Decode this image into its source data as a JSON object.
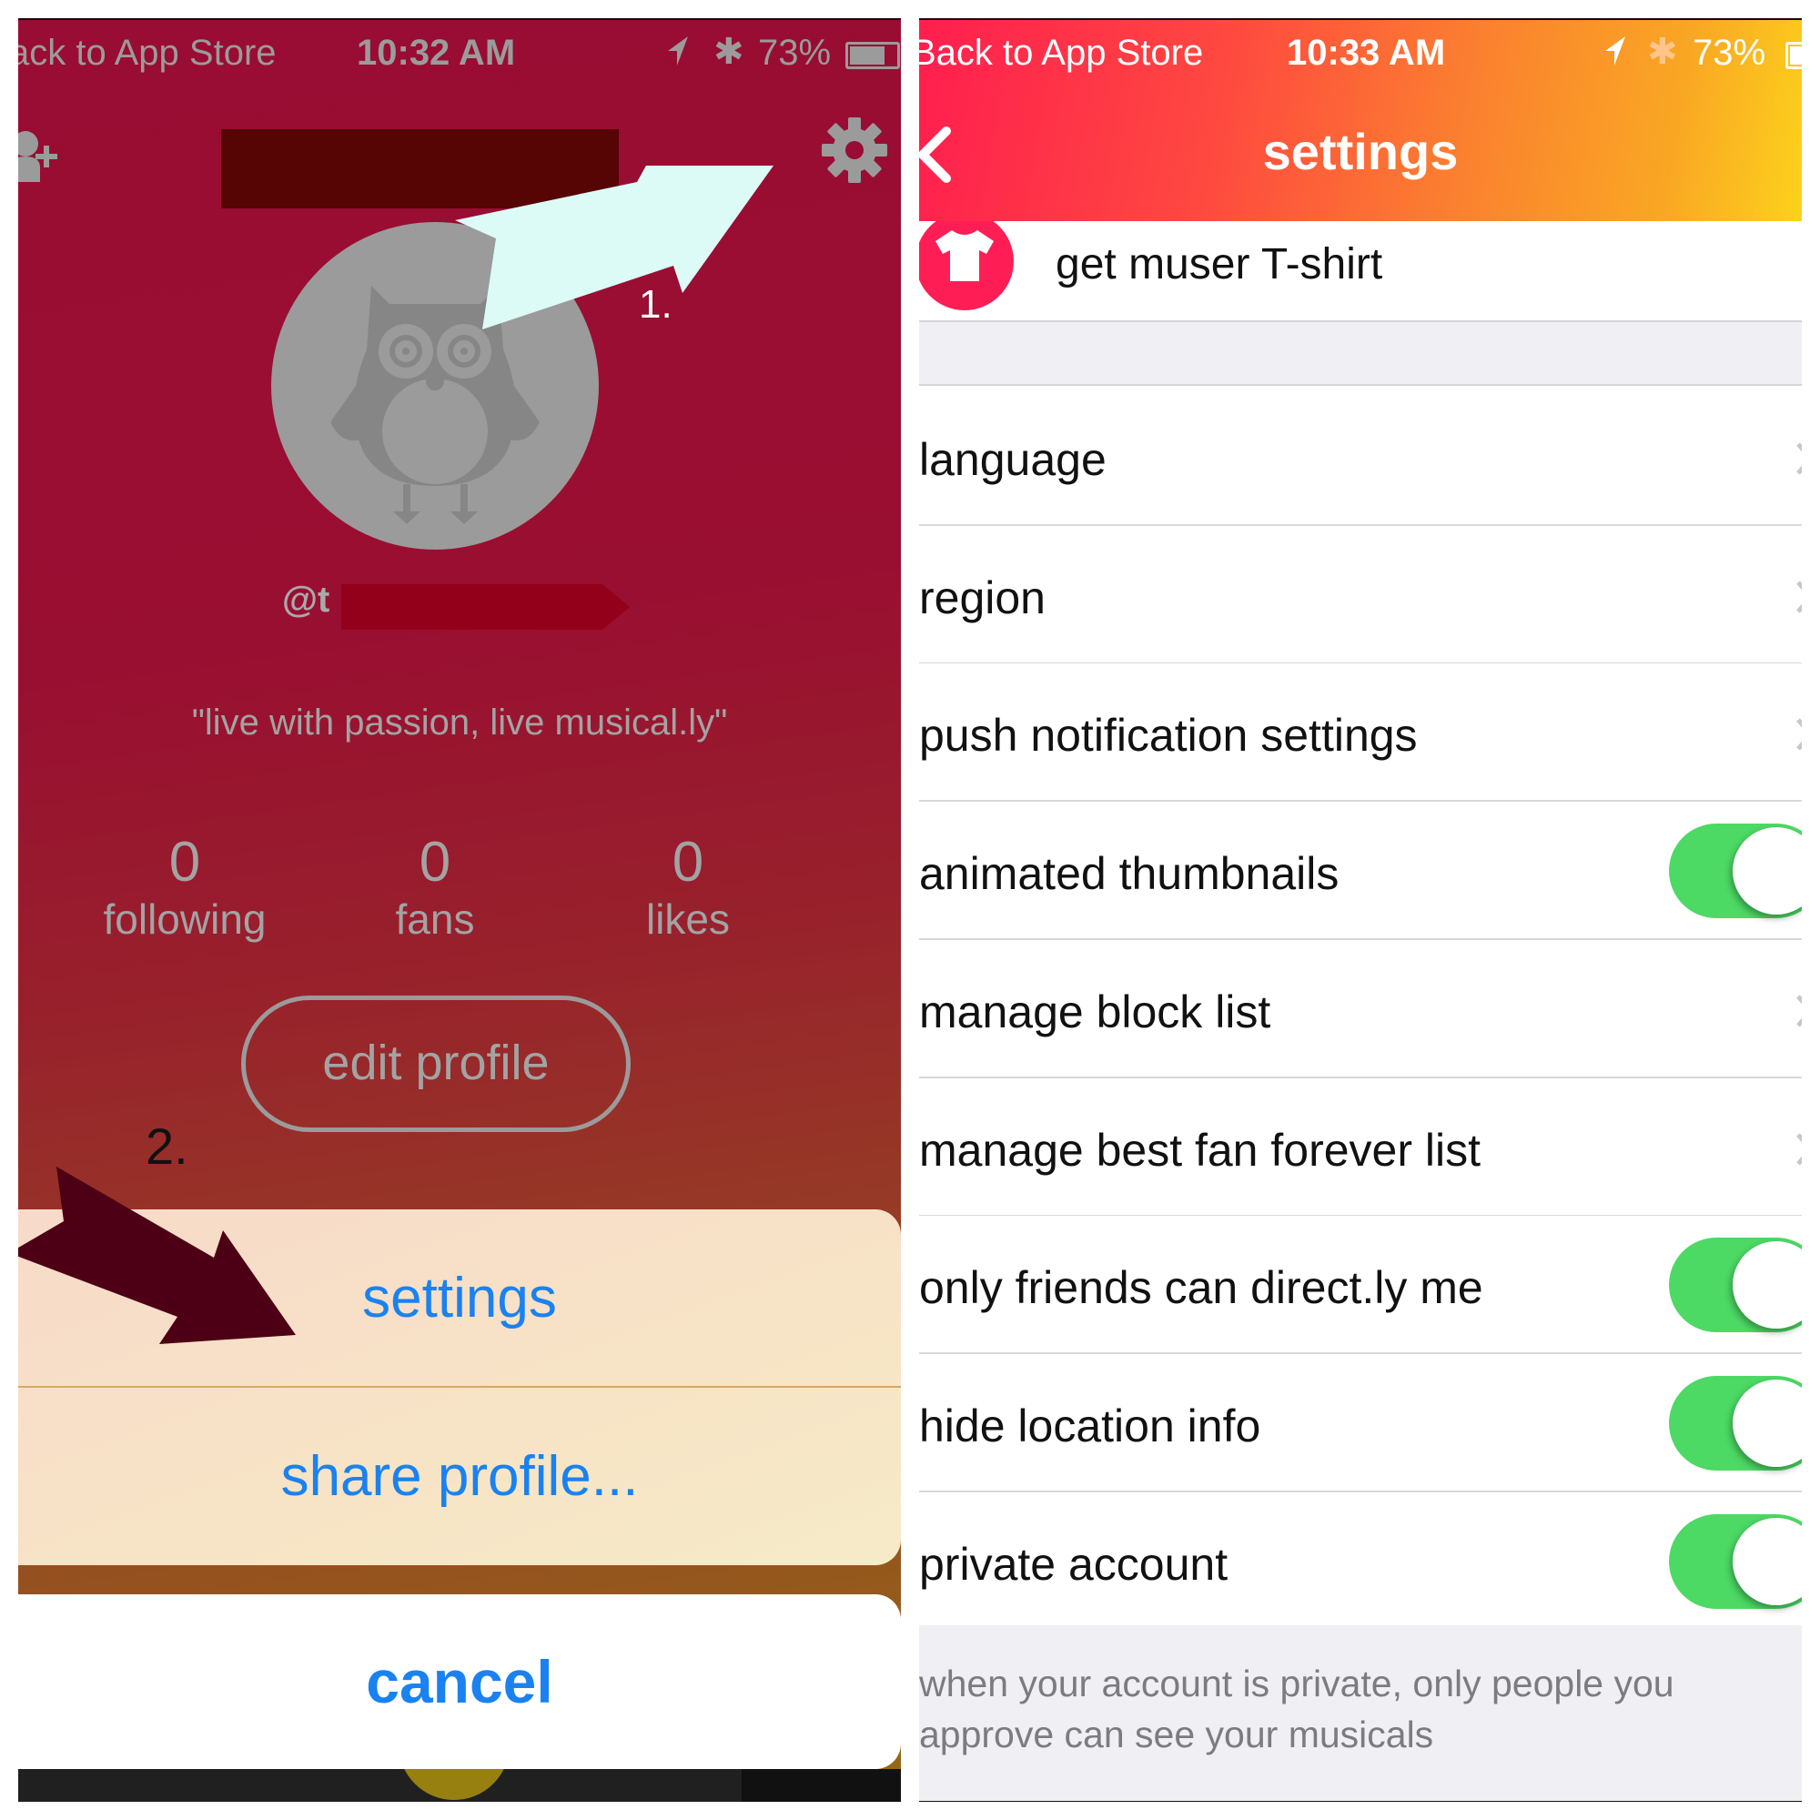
{
  "left_screen": {
    "status_bar": {
      "back_label": "ack to App Store",
      "time": "10:32 AM",
      "battery_percent": "73%",
      "battery_level": 0.73,
      "icons": [
        "location-arrow-icon",
        "bluetooth-icon",
        "battery-icon"
      ]
    },
    "header": {
      "add_user_icon": "add-user-icon",
      "settings_icon": "gear-icon"
    },
    "profile": {
      "avatar_icon": "owl-placeholder-icon",
      "handle_visible": "@t",
      "bio": "\"live with passion, live musical.ly\"",
      "stats": [
        {
          "value": "0",
          "label": "following"
        },
        {
          "value": "0",
          "label": "fans"
        },
        {
          "value": "0",
          "label": "likes"
        }
      ],
      "edit_profile_label": "edit profile"
    },
    "annotations": {
      "step1": "1.",
      "step2": "2."
    },
    "action_sheet": {
      "items": [
        {
          "label": "settings"
        },
        {
          "label": "share profile..."
        }
      ],
      "cancel_label": "cancel"
    },
    "colors": {
      "sheet_text": "#1a82f0",
      "arrow1": "#dcfbf6",
      "arrow2": "#4d0015",
      "redaction": "#560404"
    }
  },
  "right_screen": {
    "status_bar": {
      "back_label": "Back to App Store",
      "time": "10:33 AM",
      "battery_percent": "73%",
      "battery_level": 0.73
    },
    "nav": {
      "back_icon": "chevron-left-icon",
      "title": "settings"
    },
    "tshirt_row": {
      "icon": "tshirt-icon",
      "label": "get muser T-shirt"
    },
    "rows": [
      {
        "label": "language",
        "type": "link"
      },
      {
        "label": "region",
        "type": "link"
      },
      {
        "label": "push notification settings",
        "type": "link"
      },
      {
        "label": "animated thumbnails",
        "type": "toggle",
        "on": true
      },
      {
        "label": "manage block list",
        "type": "link"
      },
      {
        "label": "manage best fan forever list",
        "type": "link"
      },
      {
        "label": "only friends can direct.ly me",
        "type": "toggle",
        "on": true
      },
      {
        "label": "hide location info",
        "type": "toggle",
        "on": true
      },
      {
        "label": "private account",
        "type": "toggle",
        "on": true
      }
    ],
    "footer_note": "when your account is private, only people you approve can see your musicals",
    "colors": {
      "toggle_on": "#4cd964",
      "accent": "#fe1e55"
    }
  }
}
